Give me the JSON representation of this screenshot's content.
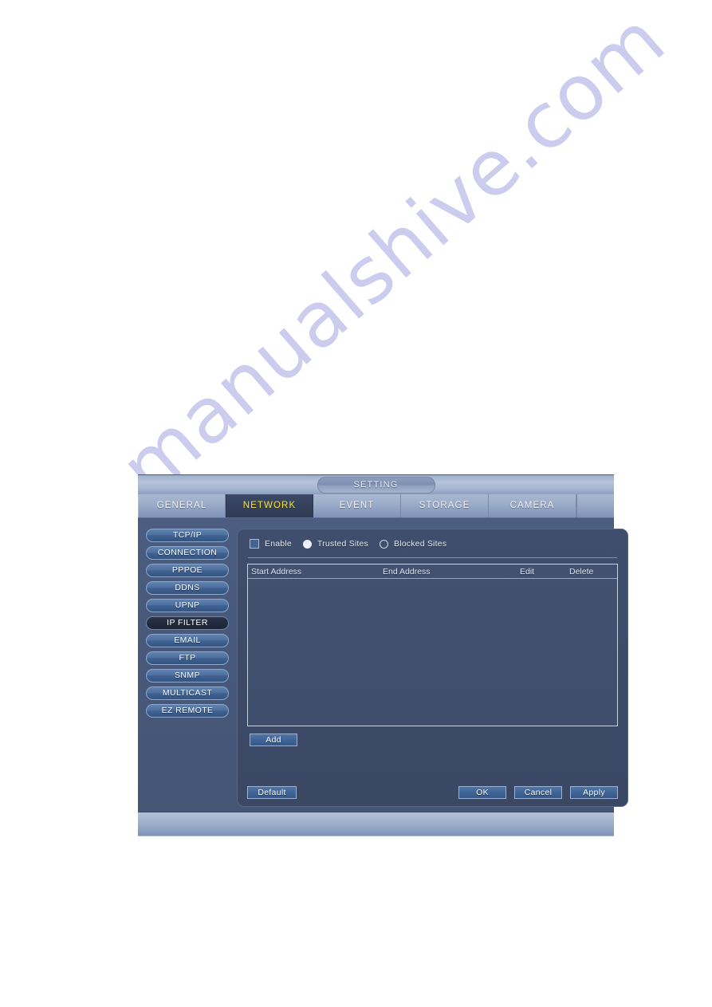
{
  "watermark": {
    "text": "manualshive.com"
  },
  "window": {
    "title": "SETTING",
    "tabs": [
      {
        "label": "GENERAL",
        "active": false
      },
      {
        "label": "NETWORK",
        "active": true
      },
      {
        "label": "EVENT",
        "active": false
      },
      {
        "label": "STORAGE",
        "active": false
      },
      {
        "label": "CAMERA",
        "active": false
      }
    ],
    "sidebar": {
      "items": [
        {
          "label": "TCP/IP",
          "active": false
        },
        {
          "label": "CONNECTION",
          "active": false
        },
        {
          "label": "PPPOE",
          "active": false
        },
        {
          "label": "DDNS",
          "active": false
        },
        {
          "label": "UPNP",
          "active": false
        },
        {
          "label": "IP FILTER",
          "active": true
        },
        {
          "label": "EMAIL",
          "active": false
        },
        {
          "label": "FTP",
          "active": false
        },
        {
          "label": "SNMP",
          "active": false
        },
        {
          "label": "MULTICAST",
          "active": false
        },
        {
          "label": "EZ REMOTE",
          "active": false
        }
      ]
    },
    "options": {
      "enable_label": "Enable",
      "enable_checked": false,
      "trusted_label": "Trusted Sites",
      "trusted_selected": true,
      "blocked_label": "Blocked Sites",
      "blocked_selected": false
    },
    "table": {
      "columns": [
        "Start Address",
        "End Address",
        "Edit",
        "Delete"
      ],
      "rows": []
    },
    "buttons": {
      "add": "Add",
      "default": "Default",
      "ok": "OK",
      "cancel": "Cancel",
      "apply": "Apply"
    },
    "colors": {
      "active_tab_text": "#ffe033",
      "window_body": "#47587a",
      "panel": "#3c4a68",
      "menu_button": "#4c6f9f",
      "menu_button_active": "#222b3d"
    }
  }
}
